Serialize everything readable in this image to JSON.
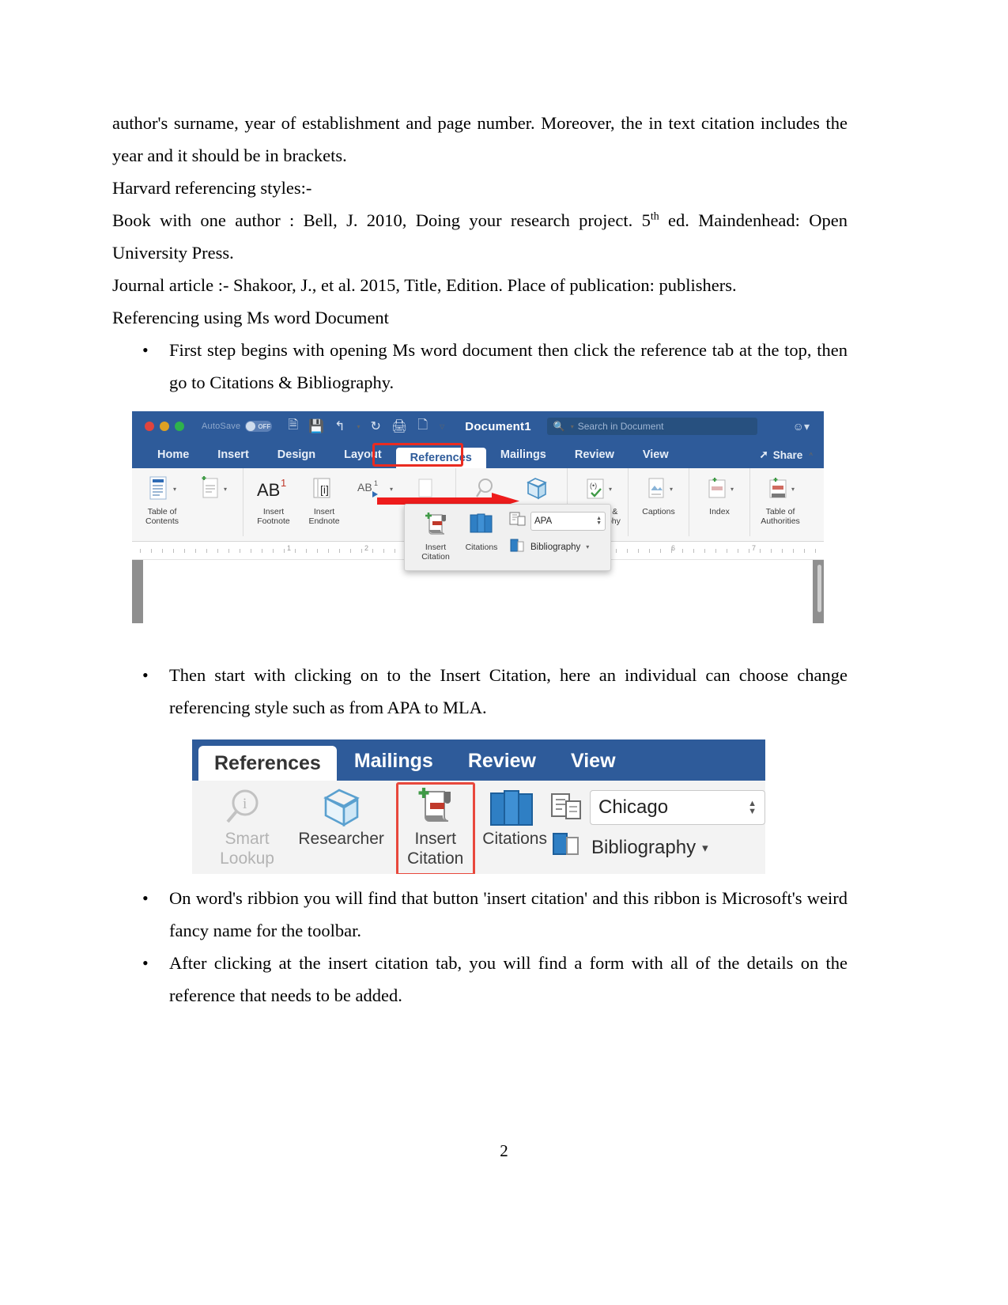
{
  "document": {
    "page_number": "2",
    "paragraphs": [
      "author's surname, year of establishment and page number. Moreover, the in text citation includes the year and it should be in brackets.",
      "Harvard referencing styles:-",
      "Journal article :- Shakoor, J., et al. 2015, Title, Edition. Place of publication: publishers.",
      "Referencing using Ms word Document"
    ],
    "book_line": {
      "before": "Book with one author : Bell, J. 2010, Doing your research project. 5",
      "sup": "th",
      "after": " ed. Maindenhead: Open University Press."
    },
    "bullets": [
      "First step begins with opening Ms word document then click the reference tab at the top, then go to Citations & Bibliography.",
      "Then start with clicking on to the Insert Citation, here an individual can choose change referencing style such as from APA to MLA.",
      "On word's ribbion you will find that button 'insert citation' and this ribbon is Microsoft's weird fancy name for the toolbar.",
      "After clicking at the insert citation tab, you will find a form with all of the details on the reference that needs to be added."
    ]
  },
  "screenshot1": {
    "titlebar": {
      "autosave_label": "AutoSave",
      "autosave_state": "OFF",
      "document_title": "Document1",
      "search_placeholder": "Search in Document"
    },
    "tabs": [
      "Home",
      "Insert",
      "Design",
      "Layout",
      "References",
      "Mailings",
      "Review",
      "View"
    ],
    "active_tab": "References",
    "highlighted_tab": "References",
    "share_label": "Share",
    "ribbon_items": [
      {
        "label": "Table of Contents",
        "dim": false
      },
      {
        "label": "Insert Footnote",
        "dim": false
      },
      {
        "label": "Insert Endnote",
        "dim": false
      },
      {
        "label": "Smart Lookup",
        "dim": true
      },
      {
        "label": "Researcher",
        "dim": false
      },
      {
        "label": "Citations & Bibliography",
        "dim": false
      },
      {
        "label": "Captions",
        "dim": false
      },
      {
        "label": "Index",
        "dim": false
      },
      {
        "label": "Table of Authorities",
        "dim": false
      }
    ],
    "ruler_numbers": [
      "1",
      "2",
      "6",
      "7"
    ],
    "dropdown": {
      "insert_citation_label": "Insert Citation",
      "citations_label": "Citations",
      "style_value": "APA",
      "bibliography_label": "Bibliography"
    },
    "colors": {
      "titlebar_blue": "#2e5b9a",
      "highlight_red": "#ea2b20",
      "arrow_red": "#ee1c1c"
    }
  },
  "screenshot2": {
    "tabs": [
      "References",
      "Mailings",
      "Review",
      "View"
    ],
    "active_tab": "References",
    "items": [
      {
        "label_top": "Smart",
        "label_bottom": "Lookup",
        "dim": true
      },
      {
        "label_top": "Researcher",
        "label_bottom": "",
        "dim": false
      },
      {
        "label_top": "Insert",
        "label_bottom": "Citation",
        "dim": false
      },
      {
        "label_top": "Citations",
        "label_bottom": "",
        "dim": false
      }
    ],
    "style_value": "Chicago",
    "bibliography_label": "Bibliography",
    "highlighted_item": "Insert Citation",
    "colors": {
      "tabbar_blue": "#2e5b9a",
      "highlight_red": "#e8483c"
    }
  }
}
